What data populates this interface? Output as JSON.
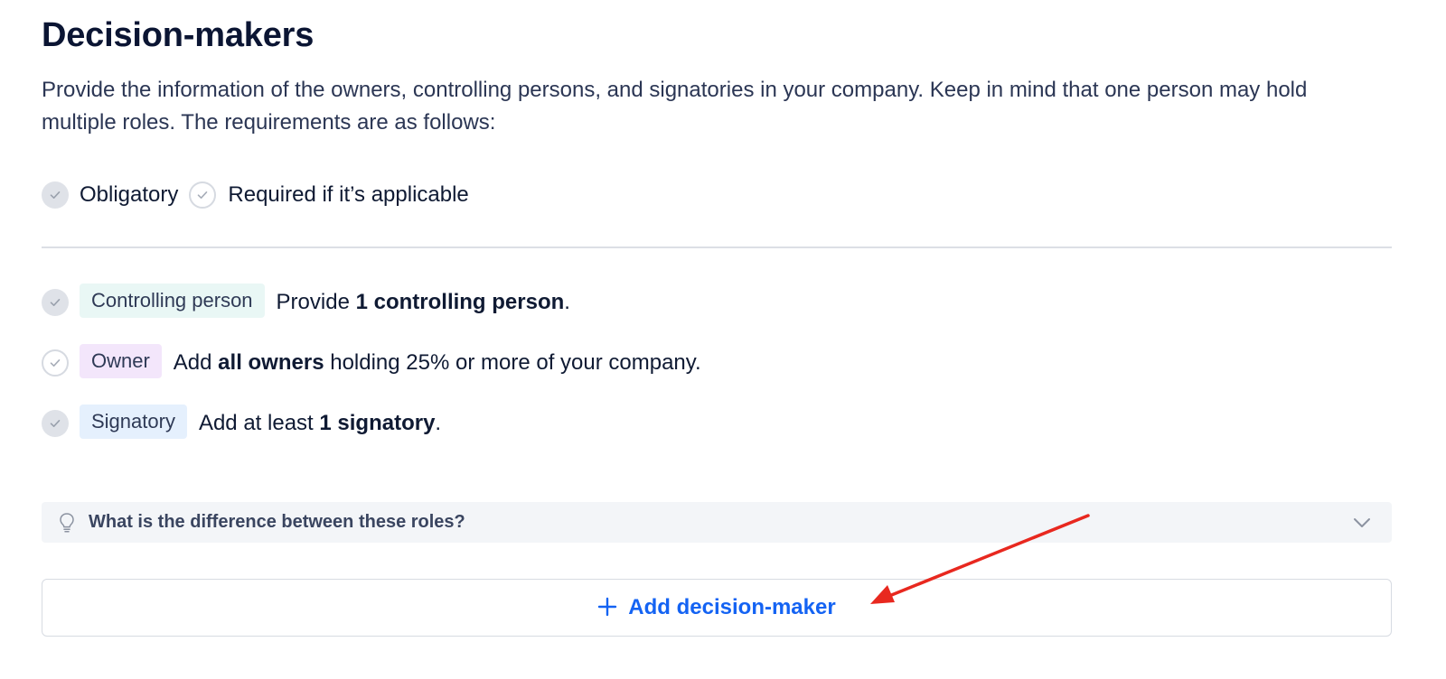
{
  "page": {
    "title": "Decision-makers",
    "intro": "Provide the information of the owners, controlling persons, and signatories in your company. Keep in mind that one person may hold multiple roles. The requirements are as follows:"
  },
  "legend": {
    "obligatory_label": "Obligatory",
    "applicable_label": "Required if it’s applicable"
  },
  "requirements": [
    {
      "tag": "Controlling person",
      "text_before": "Provide ",
      "text_bold": "1 controlling person",
      "text_after": ".",
      "indicator": "obligatory"
    },
    {
      "tag": "Owner",
      "text_before": "Add ",
      "text_bold": "all owners",
      "text_after": " holding 25% or more of your company.",
      "indicator": "applicable"
    },
    {
      "tag": "Signatory",
      "text_before": "Add at least ",
      "text_bold": "1 signatory",
      "text_after": ".",
      "indicator": "obligatory"
    }
  ],
  "faq": {
    "question": "What is the difference between these roles?",
    "icon": "lightbulb-icon",
    "toggle_icon": "chevron-down-icon"
  },
  "actions": {
    "add_label": "Add decision-maker",
    "add_icon": "plus-icon"
  },
  "colors": {
    "accent": "#1463f3",
    "annotation_arrow": "#e8281f",
    "tag_controlling": "#e9f7f5",
    "tag_owner": "#f3e6fb",
    "tag_signatory": "#e5f0fd"
  }
}
